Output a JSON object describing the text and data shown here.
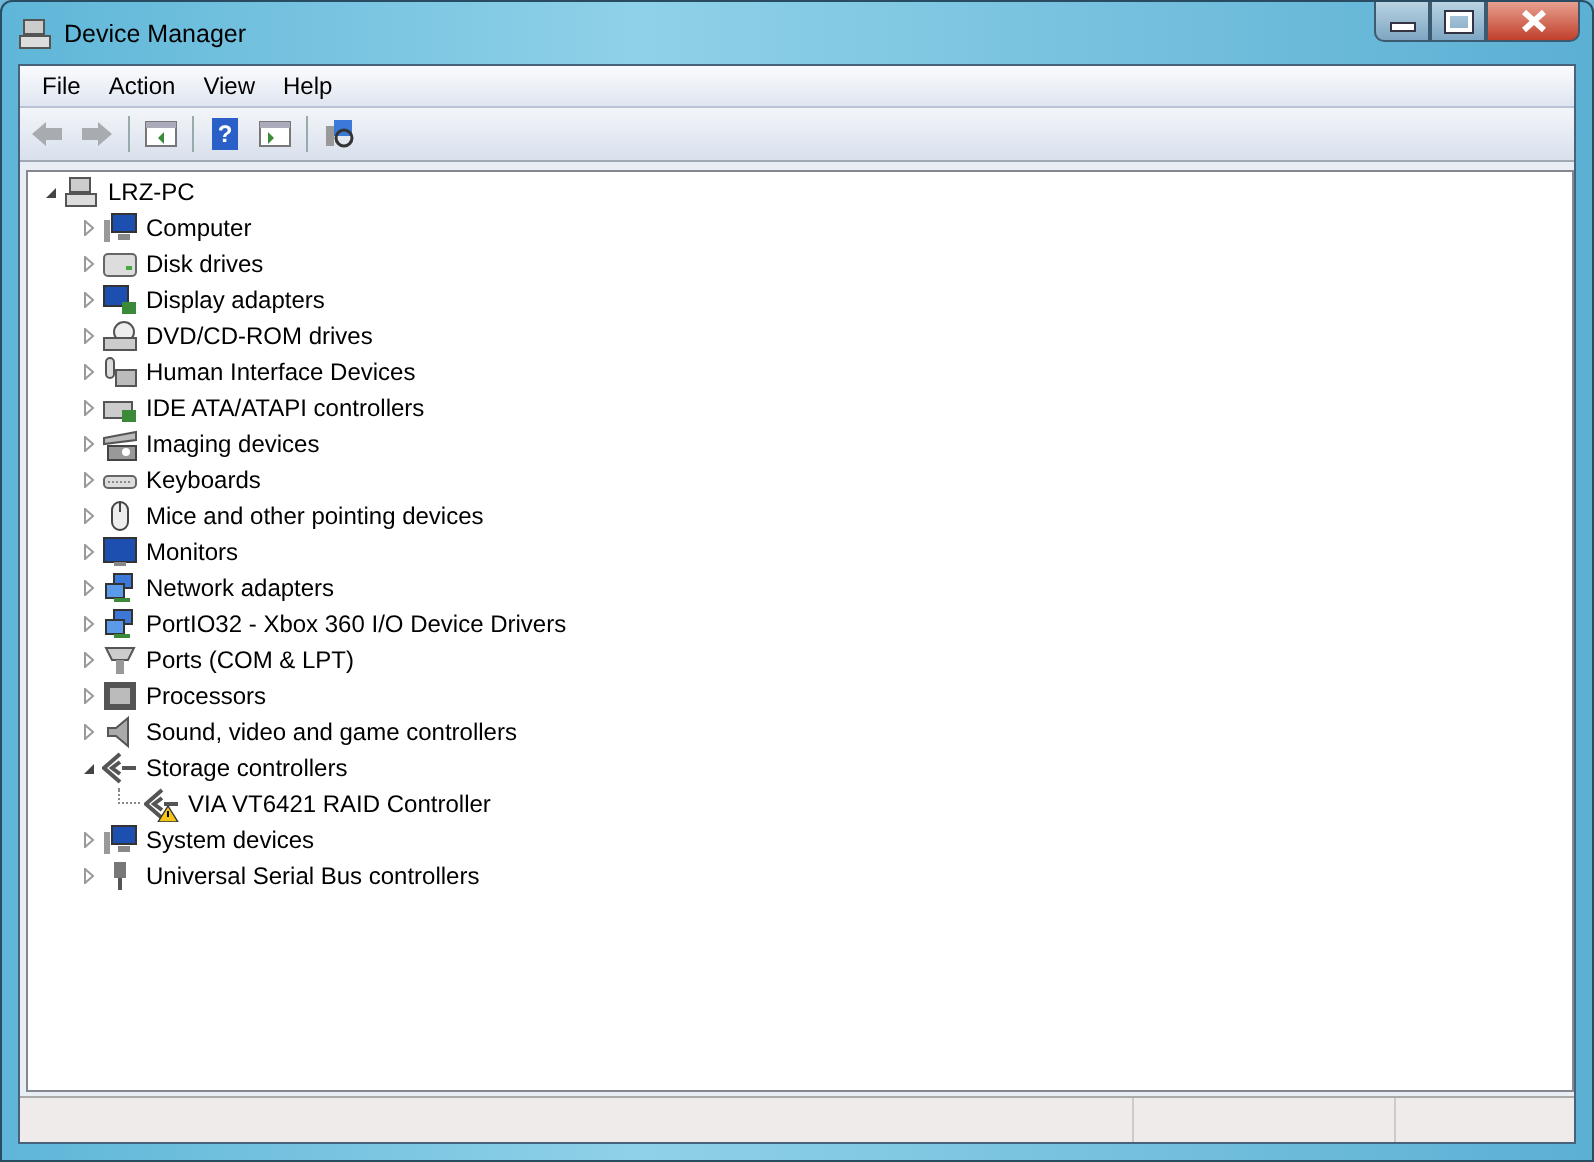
{
  "window": {
    "title": "Device Manager"
  },
  "menu": [
    "File",
    "Action",
    "View",
    "Help"
  ],
  "toolbar": [
    {
      "kind": "back"
    },
    {
      "kind": "forward"
    },
    {
      "kind": "separator"
    },
    {
      "kind": "console-tree"
    },
    {
      "kind": "separator"
    },
    {
      "kind": "help",
      "label": "?"
    },
    {
      "kind": "action-pane"
    },
    {
      "kind": "separator"
    },
    {
      "kind": "scan"
    }
  ],
  "tree": {
    "label": "LRZ-PC",
    "kind": "pc",
    "expanded": true,
    "children": [
      {
        "label": "Computer",
        "kind": "computer",
        "expanded": false
      },
      {
        "label": "Disk drives",
        "kind": "disk",
        "expanded": false
      },
      {
        "label": "Display adapters",
        "kind": "display",
        "expanded": false
      },
      {
        "label": "DVD/CD-ROM drives",
        "kind": "dvd",
        "expanded": false
      },
      {
        "label": "Human Interface Devices",
        "kind": "hid",
        "expanded": false
      },
      {
        "label": "IDE ATA/ATAPI controllers",
        "kind": "ide",
        "expanded": false
      },
      {
        "label": "Imaging devices",
        "kind": "camera",
        "expanded": false
      },
      {
        "label": "Keyboards",
        "kind": "keyboard",
        "expanded": false
      },
      {
        "label": "Mice and other pointing devices",
        "kind": "mouse",
        "expanded": false
      },
      {
        "label": "Monitors",
        "kind": "monitor",
        "expanded": false
      },
      {
        "label": "Network adapters",
        "kind": "network",
        "expanded": false
      },
      {
        "label": "PortIO32 - Xbox 360 I/O Device Drivers",
        "kind": "network",
        "expanded": false
      },
      {
        "label": "Ports (COM & LPT)",
        "kind": "port",
        "expanded": false
      },
      {
        "label": "Processors",
        "kind": "cpu",
        "expanded": false
      },
      {
        "label": "Sound, video and game controllers",
        "kind": "sound",
        "expanded": false
      },
      {
        "label": "Storage controllers",
        "kind": "storage",
        "expanded": true,
        "children": [
          {
            "label": "VIA VT6421 RAID Controller",
            "kind": "storage",
            "warning": true
          }
        ]
      },
      {
        "label": "System devices",
        "kind": "computer",
        "expanded": false
      },
      {
        "label": "Universal Serial Bus controllers",
        "kind": "usb",
        "expanded": false
      }
    ]
  }
}
